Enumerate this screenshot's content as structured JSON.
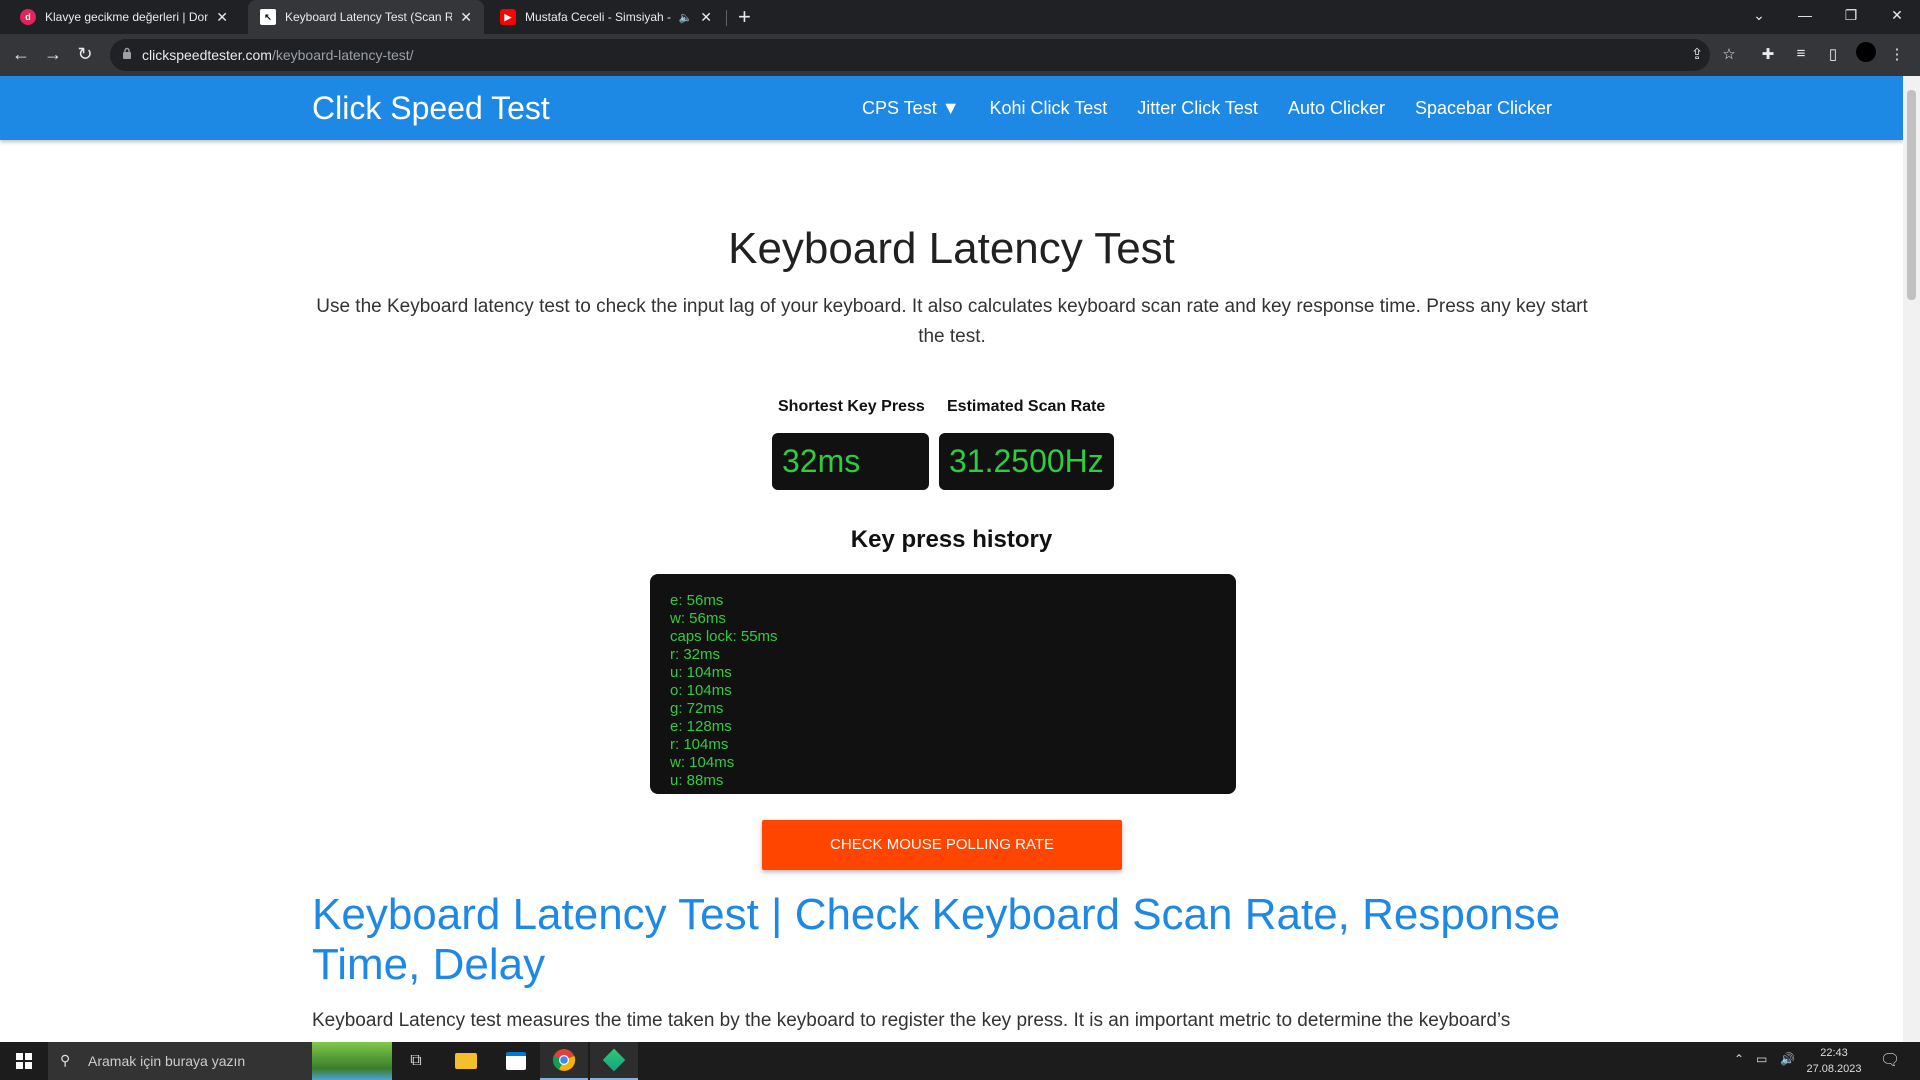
{
  "browser": {
    "tabs": [
      {
        "title": "Klavye gecikme değerleri | Donan",
        "favicon_color": "#e0245e"
      },
      {
        "title": "Keyboard Latency Test (Scan Rate",
        "favicon_color": "#ffffff"
      },
      {
        "title": "Mustafa Ceceli - Simsiyah - Y",
        "favicon_color": "#ff0000"
      }
    ],
    "url_domain": "clickspeedtester.com",
    "url_path": "/keyboard-latency-test/"
  },
  "site": {
    "brand": "Click Speed Test",
    "nav": [
      "CPS Test ▼",
      "Kohi Click Test",
      "Jitter Click Test",
      "Auto Clicker",
      "Spacebar Clicker"
    ],
    "accent": "#1e88e5"
  },
  "main": {
    "title": "Keyboard Latency Test",
    "intro": "Use the Keyboard latency test to check the input lag of your keyboard. It also calculates keyboard scan rate and key response time. Press any key start the test.",
    "shortest_label": "Shortest Key Press",
    "shortest_value": "32ms",
    "scan_label": "Estimated Scan Rate",
    "scan_value": "31.2500Hz",
    "history_title": "Key press history",
    "history": [
      "e: 56ms",
      "w: 56ms",
      "caps lock: 55ms",
      "r: 32ms",
      "u: 104ms",
      "o: 104ms",
      "g: 72ms",
      "e: 128ms",
      "r: 104ms",
      "w: 104ms",
      "u: 88ms"
    ],
    "cta": "CHECK MOUSE POLLING RATE",
    "heading2": "Keyboard Latency Test | Check Keyboard Scan Rate, Response Time, Delay",
    "paragraph": "Keyboard Latency test measures the time taken by the keyboard to register the key press. It is an important metric to determine the keyboard’s"
  },
  "taskbar": {
    "search_placeholder": "Aramak için buraya yazın",
    "time": "22:43",
    "date": "27.08.2023"
  }
}
